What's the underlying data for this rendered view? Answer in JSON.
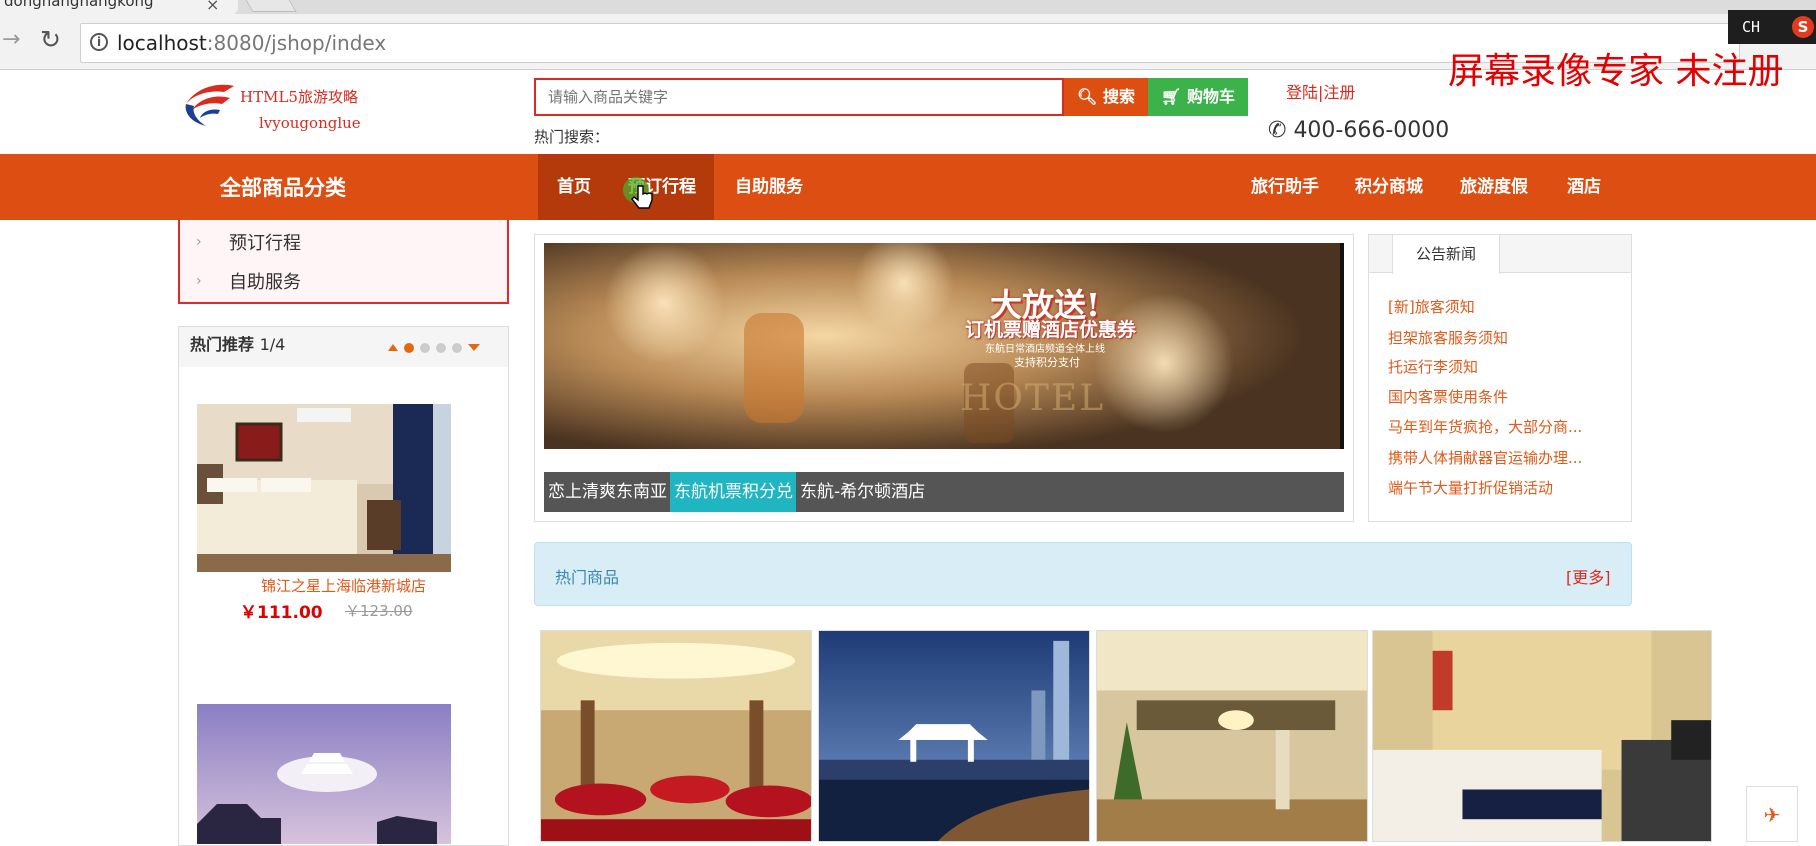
{
  "browser": {
    "tab_title": "donghanghangkong",
    "tab_close": "×",
    "url_host": "localhost",
    "url_rest": ":8080/jshop/index",
    "ime_label": "CH",
    "ime_s": "S"
  },
  "watermark": "屏幕录像专家 未注册",
  "header": {
    "logo_title": "HTML5旅游攻略",
    "logo_sub": "lvyougonglue",
    "search_placeholder": "请输入商品关键字",
    "search_btn": "搜索",
    "cart_btn": "购物车",
    "hot_search_label": "热门搜索：",
    "login_link": "登陆|注册",
    "phone": "400-666-0000"
  },
  "nav": {
    "all_categories": "全部商品分类",
    "home": "首页",
    "booking": "预订行程",
    "self_service": "自助服务",
    "assistant": "旅行助手",
    "points_mall": "积分商城",
    "vacation": "旅游度假",
    "hotel": "酒店"
  },
  "category_dropdown": [
    "预订行程",
    "自助服务"
  ],
  "recommend": {
    "title": "热门推荐",
    "page": "1/4",
    "page_dots": 5,
    "active_dot": 0,
    "item_name": "锦江之星上海临港新城店",
    "item_price": "￥111.00",
    "item_old_price": "￥123.00"
  },
  "carousel": {
    "promo_title": "大放送!",
    "promo_sub": "订机票赠酒店优惠券",
    "promo_line": "东航日常酒店频道全体上线",
    "promo_line2": "支持积分支付",
    "promo_hotel": "HOTEL",
    "tabs": [
      "恋上清爽东南亚",
      "东航机票积分兑",
      "东航-希尔顿酒店"
    ],
    "active_tab": 1
  },
  "news": {
    "tab": "公告新闻",
    "items": [
      "[新]旅客须知",
      "担架旅客服务须知",
      "托运行李须知",
      "国内客票使用条件",
      "马年到年货疯抢，大部分商...",
      "携带人体捐献器官运输办理...",
      "端午节大量打折促销活动"
    ]
  },
  "hot_goods": {
    "title": "热门商品",
    "more": "[更多]"
  },
  "colors": {
    "brand_orange": "#dc4e12",
    "brand_red": "#d92b1f",
    "cart_green": "#3cb24a",
    "tab_cyan": "#1fb5c1"
  }
}
